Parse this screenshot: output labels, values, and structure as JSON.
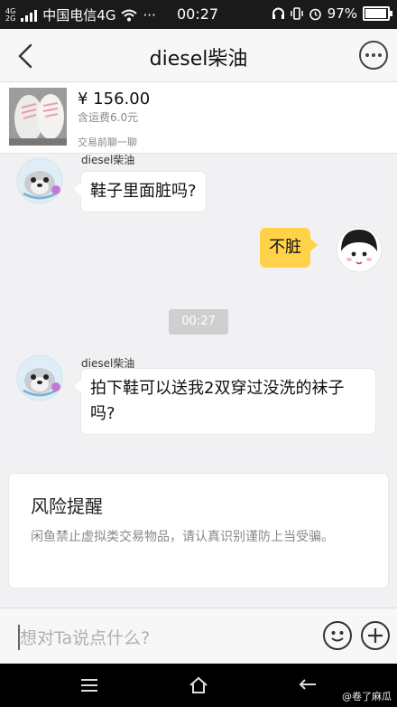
{
  "status_bar": {
    "network_small_top": "4G",
    "network_small_bottom": "2G",
    "carrier": "中国电信4G",
    "more": "···",
    "time": "00:27",
    "battery": "97%"
  },
  "header": {
    "title": "diesel柴油"
  },
  "product": {
    "price": "¥ 156.00",
    "shipping": "含运费6.0元",
    "chat_prompt": "交易前聊一聊"
  },
  "messages": [
    {
      "sender": "diesel柴油",
      "text": "鞋子里面脏吗?"
    },
    {
      "text": "不脏"
    },
    {
      "time": "00:27"
    },
    {
      "sender": "diesel柴油",
      "text": "拍下鞋可以送我2双穿过没洗的袜子吗?"
    }
  ],
  "risk_notice": {
    "title": "风险提醒",
    "body": "闲鱼禁止虚拟类交易物品，请认真识别谨防上当受骗。"
  },
  "composer": {
    "placeholder": "想对Ta说点什么?"
  },
  "watermark": "@卷了麻瓜",
  "colors": {
    "my_bubble": "#ffd24a",
    "status_bar": "#1a1a1a"
  },
  "icons": [
    "back-icon",
    "more-icon",
    "emoji-icon",
    "add-icon",
    "menu-icon",
    "home-icon",
    "return-icon"
  ]
}
